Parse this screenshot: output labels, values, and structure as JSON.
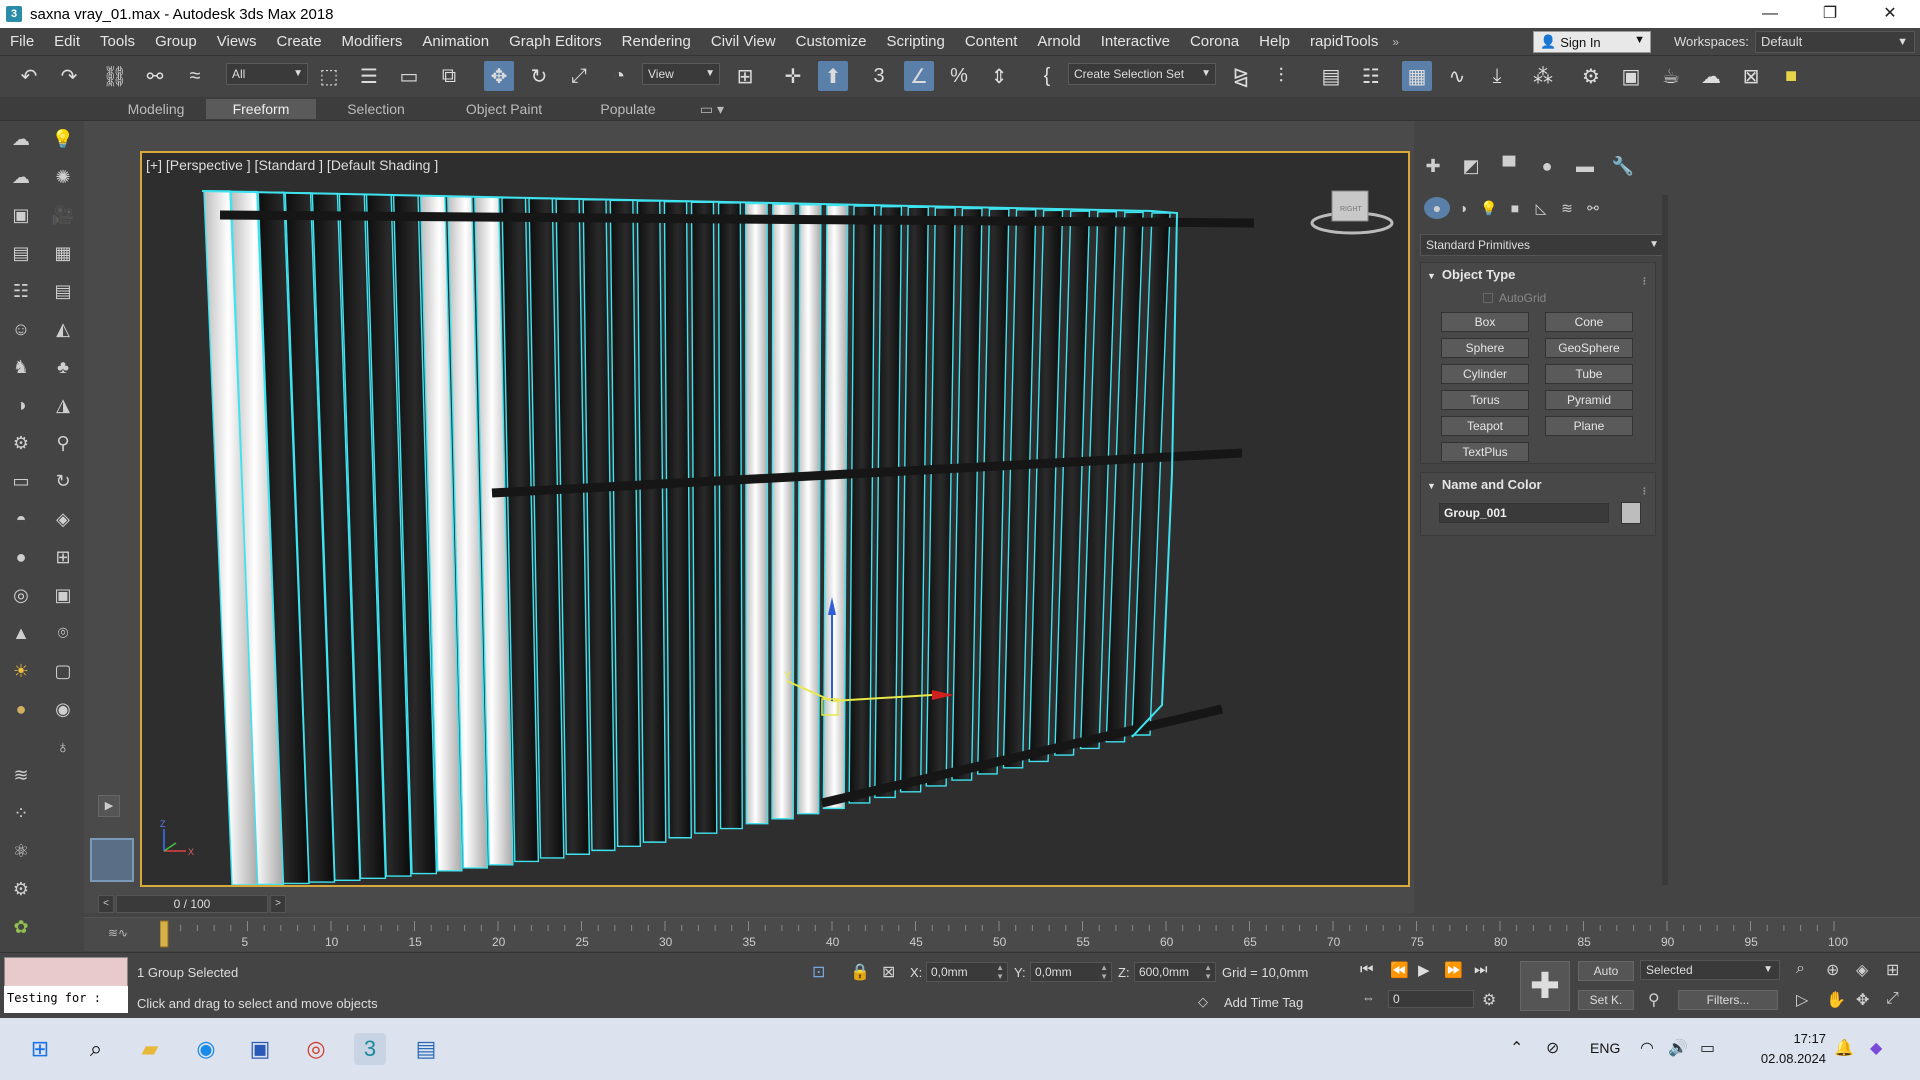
{
  "window": {
    "title": "saxna vray_01.max - Autodesk 3ds Max 2018",
    "app_icon_glyph": "3",
    "controls": [
      "—",
      "❐",
      "✕"
    ]
  },
  "menu": {
    "items": [
      "File",
      "Edit",
      "Tools",
      "Group",
      "Views",
      "Create",
      "Modifiers",
      "Animation",
      "Graph Editors",
      "Rendering",
      "Civil View",
      "Customize",
      "Scripting",
      "Content",
      "Arnold",
      "Interactive",
      "Corona",
      "Help",
      "rapidTools"
    ],
    "more_glyph": "»",
    "sign_in": "Sign In",
    "workspaces_label": "Workspaces:",
    "workspace": "Default"
  },
  "toolbar": {
    "selection_filter": "All",
    "ref_coord": "View",
    "named_selection": "Create Selection Set"
  },
  "ribbon": {
    "tabs": [
      "Modeling",
      "Freeform",
      "Selection",
      "Object Paint",
      "Populate"
    ],
    "active": "Freeform"
  },
  "viewport": {
    "label": "[+] [Perspective ] [Standard ] [Default Shading ]",
    "viewcube_label": "RIGHT",
    "gizmo_axes": [
      "X",
      "Y",
      "Z"
    ],
    "selection_color": "#3fe3ef"
  },
  "command_panel": {
    "category": "Standard Primitives",
    "object_type": {
      "title": "Object Type",
      "autogrid": "AutoGrid",
      "buttons": [
        "Box",
        "Cone",
        "Sphere",
        "GeoSphere",
        "Cylinder",
        "Tube",
        "Torus",
        "Pyramid",
        "Teapot",
        "Plane",
        "TextPlus"
      ]
    },
    "name_and_color": {
      "title": "Name and Color",
      "name": "Group_001",
      "color": "#bdbdbd"
    }
  },
  "timeline": {
    "frame_display": "0 / 100",
    "ticks": [
      "5",
      "10",
      "15",
      "20",
      "25",
      "30",
      "35",
      "40",
      "45",
      "50",
      "55",
      "60",
      "65",
      "70",
      "75",
      "80",
      "85",
      "90",
      "95",
      "100"
    ],
    "frame_count": 100
  },
  "status": {
    "maxscript_text": "Testing for :",
    "selection_info": "1 Group Selected",
    "prompt": "Click and drag to select and move objects",
    "x_label": "X:",
    "x_value": "0,0mm",
    "y_label": "Y:",
    "y_value": "0,0mm",
    "z_label": "Z:",
    "z_value": "600,0mm",
    "grid": "Grid = 10,0mm",
    "add_time_tag": "Add Time Tag",
    "current_frame": "0",
    "auto_key": "Auto",
    "set_key": "Set K.",
    "key_filter": "Selected",
    "filters": "Filters..."
  },
  "taskbar": {
    "language": "ENG",
    "time": "17:17",
    "date": "02.08.2024"
  }
}
